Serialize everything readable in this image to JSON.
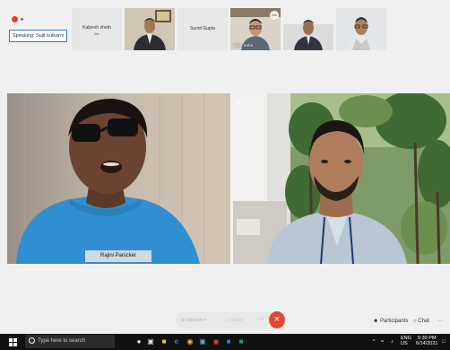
{
  "meeting": {
    "speaking_label": "Speaking: Sujit kulkarni"
  },
  "thumbnails": [
    {
      "name": "Kalpesh sheth",
      "sub": "Me"
    },
    {
      "name": "Sumit Gupta"
    },
    {
      "name": "Rajib Saha"
    }
  ],
  "tiles": {
    "main_name": "Rajini Panicker"
  },
  "controls": {
    "unmute": "Unmute",
    "share": "Share",
    "more": "···",
    "leave": "×",
    "participants": "Participants",
    "chat": "Chat",
    "overflow": "···"
  },
  "taskbar": {
    "search_placeholder": "Type here to search",
    "time": "5:39 PM",
    "date": "6/14/2021",
    "language_top": "ENG",
    "language_bottom": "US",
    "accent_color": "#e0473a"
  },
  "icons": [
    "record-icon",
    "pin-icon",
    "mic-off-icon",
    "share-icon",
    "participants-icon",
    "chat-icon",
    "windows-icon",
    "search-icon",
    "task-view-icon",
    "edge-icon",
    "chrome-icon",
    "folder-icon",
    "outlook-icon",
    "excel-icon"
  ]
}
